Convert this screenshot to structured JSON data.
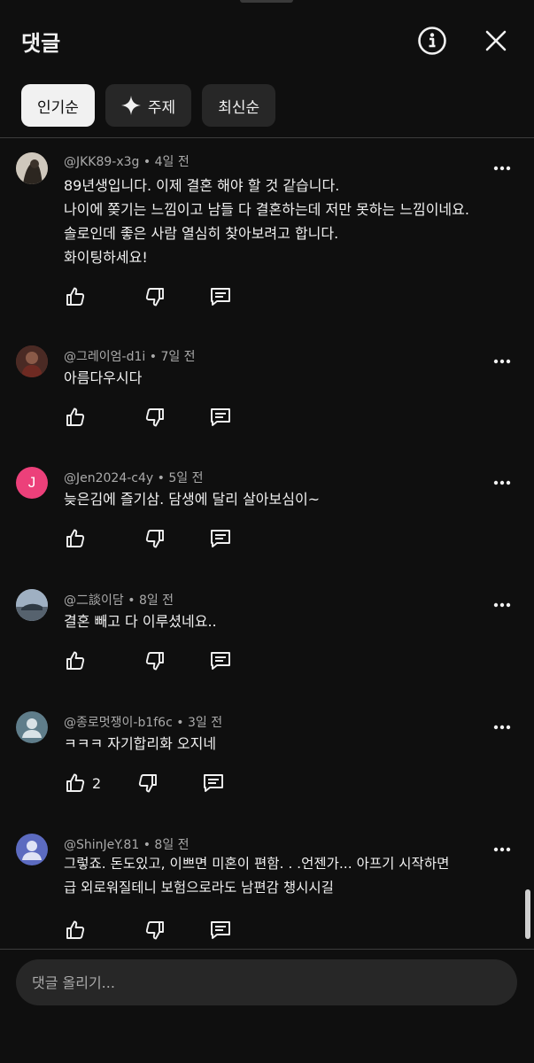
{
  "header": {
    "title": "댓글"
  },
  "chips": [
    {
      "label": "인기순",
      "active": true
    },
    {
      "label": "주제",
      "active": false
    },
    {
      "label": "최신순",
      "active": false
    }
  ],
  "comments": [
    {
      "author": "@JKK89-x3g",
      "time": "4일 전",
      "text": "89년생입니다. 이제 결혼 해야 할 것 같습니다.\n나이에 쫒기는 느낌이고 남들 다 결혼하는데 저만 못하는 느낌이네요.\n솔로인데 좋은 사람 열심히 찾아보려고 합니다.\n화이팅하세요!",
      "likes": "",
      "avatar_color": "#6b5a4a"
    },
    {
      "author": "@그레이엄-d1i",
      "time": "7일 전",
      "text": "아름다우시다",
      "likes": "",
      "avatar_color": "#7a3a30"
    },
    {
      "author": "@Jen2024-c4y",
      "time": "5일 전",
      "text": "늦은김에 즐기삼. 담생에 달리 살아보심이~",
      "likes": "",
      "avatar_letter": "J",
      "avatar_color": "#ec407a"
    },
    {
      "author": "@二談이담",
      "time": "8일 전",
      "text": "결혼 빼고 다 이루셨네요..",
      "likes": "",
      "avatar_color": "#8fa0b3"
    },
    {
      "author": "@종로멋쟁이-b1f6c",
      "time": "3일 전",
      "text": "ㅋㅋㅋ 자기합리화 오지네",
      "likes": "2",
      "avatar_color": "#5f7d8a"
    },
    {
      "author": "@ShinJeY.81",
      "time": "8일 전",
      "text": "그렇죠. 돈도있고, 이쁘면 미혼이 편함. . .언젠가... 아프기 시작하면\n급 외로워질테니 보험으로라도 남편감 챙시시길",
      "likes": "",
      "avatar_color": "#5c6bc0"
    }
  ],
  "input": {
    "placeholder": "댓글 올리기..."
  },
  "colors": {
    "background": "#0f0f0f",
    "chip": "#272727",
    "chip_active": "#f1f1f1",
    "meta_text": "#aaaaaa"
  },
  "icons": [
    "info-icon",
    "close-icon",
    "sparkle-icon",
    "thumbs-up-icon",
    "thumbs-down-icon",
    "reply-icon",
    "more-vert-icon",
    "person-icon"
  ]
}
